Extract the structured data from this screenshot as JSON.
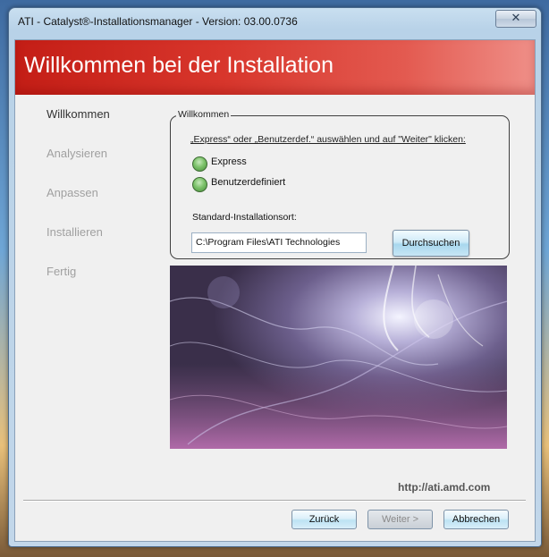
{
  "window": {
    "title": "ATI - Catalyst®-Installationsmanager - Version: 03.00.0736",
    "close_glyph": "✕"
  },
  "banner": {
    "title": "Willkommen bei der Installation"
  },
  "steps": [
    {
      "label": "Willkommen",
      "active": true
    },
    {
      "label": "Analysieren",
      "active": false
    },
    {
      "label": "Anpassen",
      "active": false
    },
    {
      "label": "Installieren",
      "active": false
    },
    {
      "label": "Fertig",
      "active": false
    }
  ],
  "welcome_group": {
    "legend": "Willkommen",
    "instruction": "„Express“ oder „Benutzerdef.“ auswählen und auf \"Weiter\" klicken:",
    "options": [
      {
        "label": "Express"
      },
      {
        "label": "Benutzerdefiniert"
      }
    ],
    "location_label": "Standard-Installationsort:",
    "location_value": "C:\\Program Files\\ATI Technologies",
    "browse_label": "Durchsuchen"
  },
  "footer": {
    "url": "http://ati.amd.com",
    "back_label": "Zurück",
    "next_label": "Weiter >",
    "cancel_label": "Abbrechen"
  },
  "colors": {
    "banner": "#c41e16",
    "radio": "#7cc26a"
  }
}
